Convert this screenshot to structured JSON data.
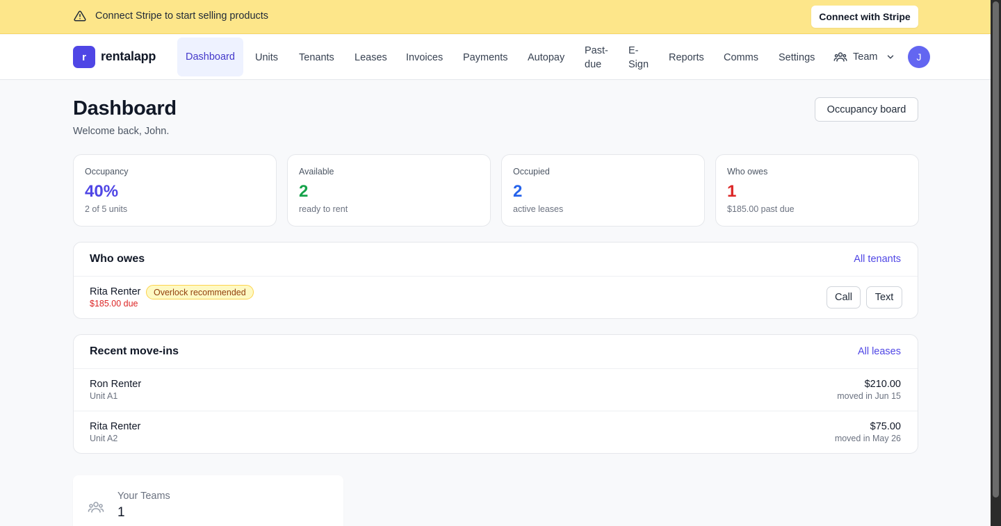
{
  "banner": {
    "icon": "warning-triangle-icon",
    "text": "Connect Stripe to start selling products",
    "button_label": "Connect with Stripe"
  },
  "nav": {
    "logo_letter": "r",
    "logo_text": "rentalapp",
    "items": [
      {
        "label": "Dashboard",
        "active": true
      },
      {
        "label": "Units"
      },
      {
        "label": "Tenants"
      },
      {
        "label": "Leases"
      },
      {
        "label": "Invoices"
      },
      {
        "label": "Payments"
      },
      {
        "label": "Autopay"
      },
      {
        "label": "Past-due"
      },
      {
        "label": "E-Sign"
      },
      {
        "label": "Reports"
      },
      {
        "label": "Comms"
      },
      {
        "label": "Settings"
      }
    ],
    "team_label": "Team",
    "team_icon": "users-icon",
    "avatar_initial": "J"
  },
  "header": {
    "title": "Dashboard",
    "subtitle": "Welcome back, John.",
    "occupancy_button": "Occupancy board"
  },
  "stats": [
    {
      "label": "Occupancy",
      "value": "40%",
      "sub": "2 of 5 units",
      "color": "#4f46e5"
    },
    {
      "label": "Available",
      "value": "2",
      "sub": "ready to rent",
      "color": "#16a34a"
    },
    {
      "label": "Occupied",
      "value": "2",
      "sub": "active leases",
      "color": "#2563eb"
    },
    {
      "label": "Who owes",
      "value": "1",
      "sub": "$185.00 past due",
      "color": "#dc2626"
    }
  ],
  "who_owes": {
    "title": "Who owes",
    "link": "All tenants",
    "rows": [
      {
        "name": "Rita Renter",
        "badge": "Overlock recommended",
        "due": "$185.00 due",
        "call": "Call",
        "text": "Text"
      }
    ]
  },
  "move_ins": {
    "title": "Recent move-ins",
    "link": "All leases",
    "rows": [
      {
        "name": "Ron Renter",
        "unit": "Unit A1",
        "amount": "$210.00",
        "date": "moved in Jun 15"
      },
      {
        "name": "Rita Renter",
        "unit": "Unit A2",
        "amount": "$75.00",
        "date": "moved in May 26"
      }
    ]
  },
  "teams": {
    "label": "Your Teams",
    "value": "1",
    "icon": "users-icon"
  }
}
